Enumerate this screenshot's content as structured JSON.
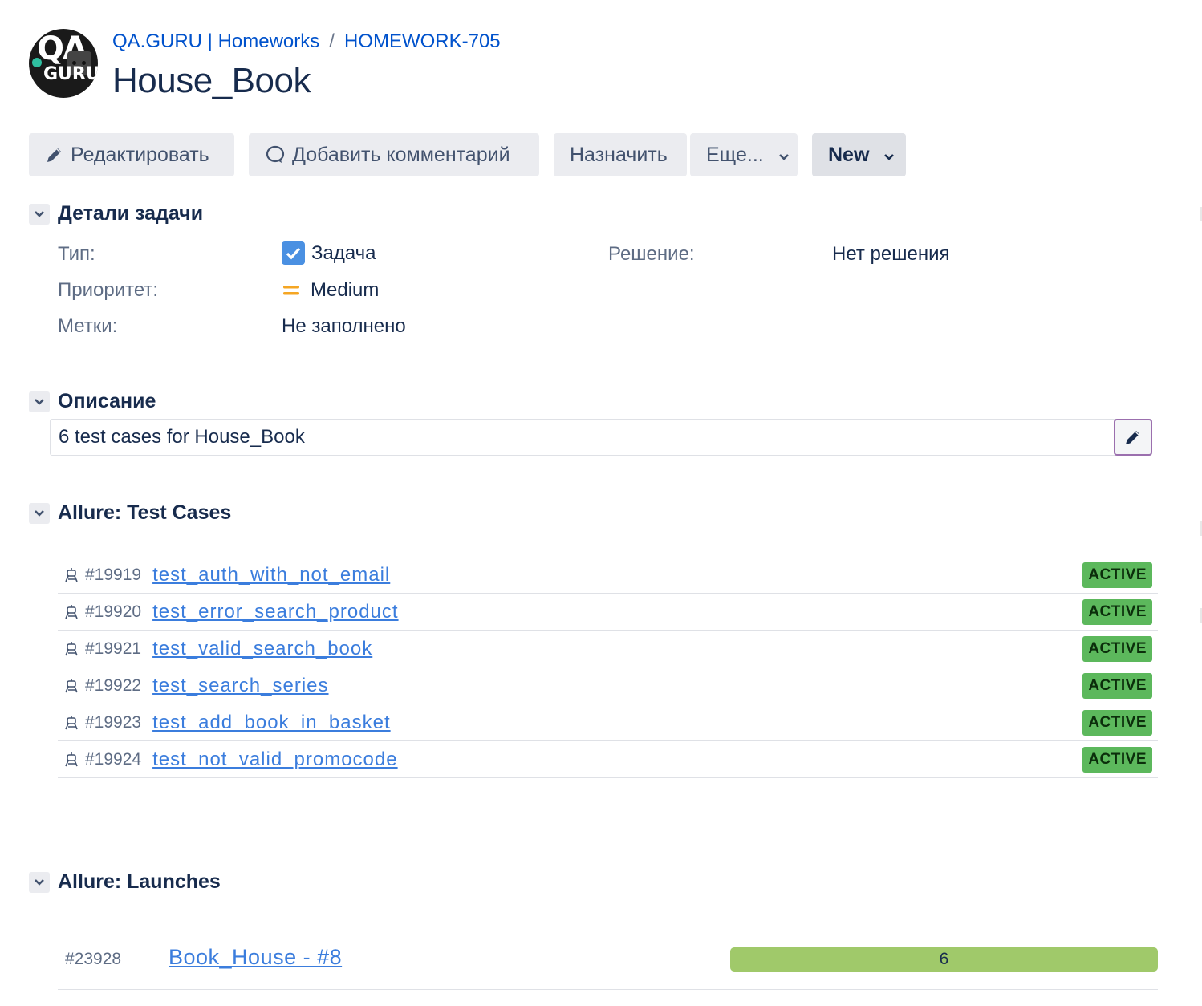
{
  "header": {
    "breadcrumb": {
      "project": "QA.GURU | Homeworks",
      "separator": "/",
      "issue_key": "HOMEWORK-705"
    },
    "title": "House_Book"
  },
  "toolbar": {
    "edit_label": "Редактировать",
    "comment_label": "Добавить комментарий",
    "assign_label": "Назначить",
    "more_label": "Еще...",
    "status_label": "New"
  },
  "details": {
    "section_title": "Детали задачи",
    "type_label": "Тип:",
    "type_value": "Задача",
    "priority_label": "Приоритет:",
    "priority_value": "Medium",
    "labels_label": "Метки:",
    "labels_value": "Не заполнено",
    "resolution_label": "Решение:",
    "resolution_value": "Нет решения"
  },
  "description": {
    "section_title": "Описание",
    "text": "6 test cases for House_Book"
  },
  "test_cases": {
    "section_title": "Allure: Test Cases",
    "items": [
      {
        "id": "#19919",
        "name": "test_auth_with_not_email",
        "status": "ACTIVE"
      },
      {
        "id": "#19920",
        "name": "test_error_search_product",
        "status": "ACTIVE"
      },
      {
        "id": "#19921",
        "name": "test_valid_search_book",
        "status": "ACTIVE"
      },
      {
        "id": "#19922",
        "name": "test_search_series",
        "status": "ACTIVE"
      },
      {
        "id": "#19923",
        "name": "test_add_book_in_basket",
        "status": "ACTIVE"
      },
      {
        "id": "#19924",
        "name": "test_not_valid_promocode",
        "status": "ACTIVE"
      }
    ]
  },
  "launches": {
    "section_title": "Allure: Launches",
    "items": [
      {
        "id": "#23928",
        "name": "Book_House - #8",
        "passed": 6
      }
    ]
  },
  "colors": {
    "link": "#0052cc",
    "active_badge": "#5cb85c",
    "launch_bar": "#a0c96a",
    "priority_medium": "#f5a623",
    "type_checkbox": "#4a90e2"
  }
}
